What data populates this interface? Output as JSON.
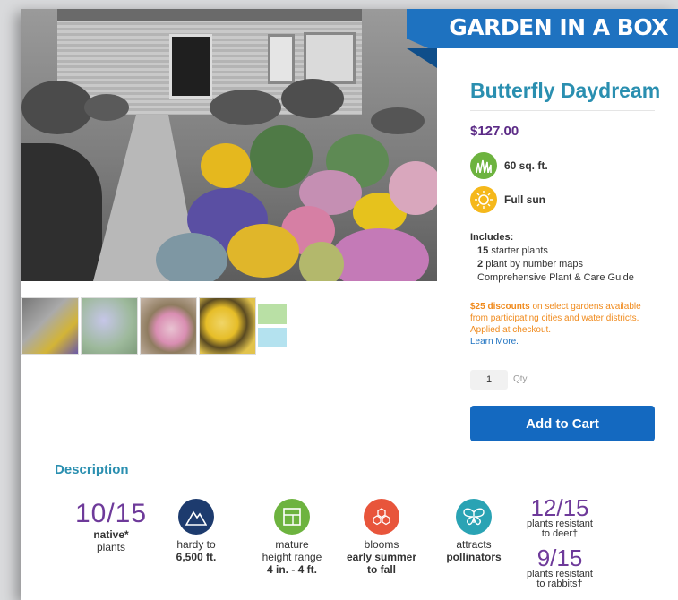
{
  "banner": {
    "brand": "GARDEN IN A BOX"
  },
  "product": {
    "title": "Butterfly Daydream",
    "price": "$127.00",
    "area": "60 sq. ft.",
    "sun": "Full sun",
    "includes_heading": "Includes:",
    "includes": [
      {
        "count": "15",
        "text": "starter plants"
      },
      {
        "count": "2",
        "text": "plant by number maps"
      },
      {
        "count": "",
        "text": "Comprehensive Plant & Care Guide"
      }
    ],
    "promo_bold": "$25 discounts",
    "promo_text": "on select gardens available from participating cities and water districts. Applied at checkout.",
    "learn_more": "Learn More.",
    "qty_value": "1",
    "qty_label": "Qty.",
    "add_to_cart": "Add to Cart"
  },
  "description": {
    "heading": "Description",
    "native": {
      "value": "10/15",
      "line1": "native*",
      "line2": "plants"
    },
    "hardy": {
      "line1": "hardy to",
      "line2": "6,500 ft."
    },
    "height": {
      "line1": "mature",
      "line2": "height range",
      "line3": "4 in. - 4 ft."
    },
    "blooms": {
      "line1": "blooms",
      "line2": "early summer",
      "line3": "to fall"
    },
    "pollinators": {
      "line1": "attracts",
      "line2": "pollinators"
    },
    "deer": {
      "value": "12/15",
      "line1": "plants resistant",
      "line2": "to deer†"
    },
    "rabbits": {
      "value": "9/15",
      "line1": "plants resistant",
      "line2": "to rabbits†"
    }
  },
  "colors": {
    "banner": "#1e72c0",
    "title": "#2a8fb0",
    "price": "#5b2a86",
    "promo": "#f08a1c",
    "button": "#1469c0",
    "stat_number": "#6e3a9a"
  }
}
